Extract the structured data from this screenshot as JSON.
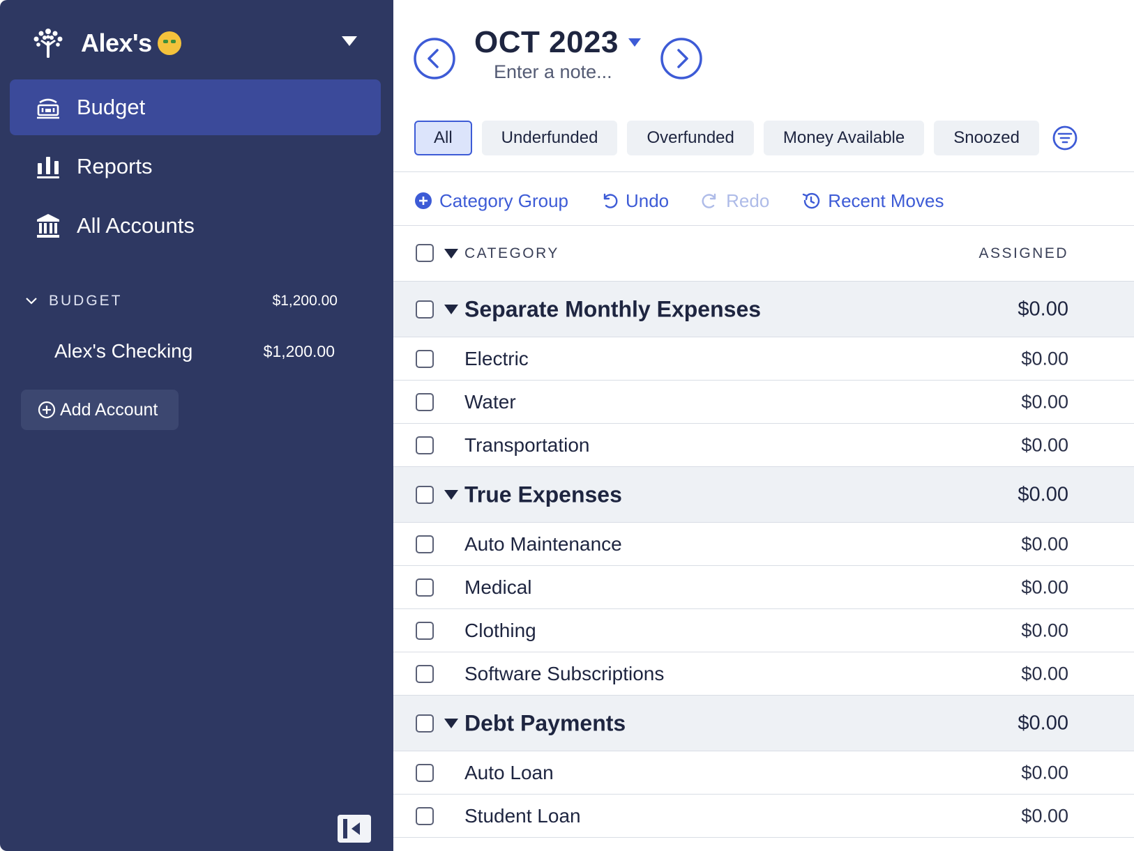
{
  "sidebar": {
    "brand_name": "Alex's",
    "nav": [
      {
        "label": "Budget",
        "icon": "budget-icon",
        "active": true
      },
      {
        "label": "Reports",
        "icon": "reports-icon",
        "active": false
      },
      {
        "label": "All Accounts",
        "icon": "bank-icon",
        "active": false
      }
    ],
    "section": {
      "label": "BUDGET",
      "amount": "$1,200.00"
    },
    "accounts": [
      {
        "name": "Alex's Checking",
        "amount": "$1,200.00"
      }
    ],
    "add_account_label": "Add Account"
  },
  "header": {
    "month": "OCT 2023",
    "note_placeholder": "Enter a note..."
  },
  "filters": [
    "All",
    "Underfunded",
    "Overfunded",
    "Money Available",
    "Snoozed"
  ],
  "active_filter": "All",
  "toolbar": {
    "category_group": "Category Group",
    "undo": "Undo",
    "redo": "Redo",
    "recent_moves": "Recent Moves"
  },
  "table": {
    "col_category": "CATEGORY",
    "col_assigned": "ASSIGNED",
    "groups": [
      {
        "name": "Separate Monthly Expenses",
        "amount": "$0.00",
        "items": [
          {
            "name": "Electric",
            "amount": "$0.00"
          },
          {
            "name": "Water",
            "amount": "$0.00"
          },
          {
            "name": "Transportation",
            "amount": "$0.00"
          }
        ]
      },
      {
        "name": "True Expenses",
        "amount": "$0.00",
        "items": [
          {
            "name": "Auto Maintenance",
            "amount": "$0.00"
          },
          {
            "name": "Medical",
            "amount": "$0.00"
          },
          {
            "name": "Clothing",
            "amount": "$0.00"
          },
          {
            "name": "Software Subscriptions",
            "amount": "$0.00"
          }
        ]
      },
      {
        "name": "Debt Payments",
        "amount": "$0.00",
        "items": [
          {
            "name": "Auto Loan",
            "amount": "$0.00"
          },
          {
            "name": "Student Loan",
            "amount": "$0.00"
          }
        ]
      }
    ]
  },
  "colors": {
    "sidebar_bg": "#2e3862",
    "active_nav": "#3b4a9a",
    "accent": "#3d5bd6",
    "group_bg": "#eef1f5"
  }
}
